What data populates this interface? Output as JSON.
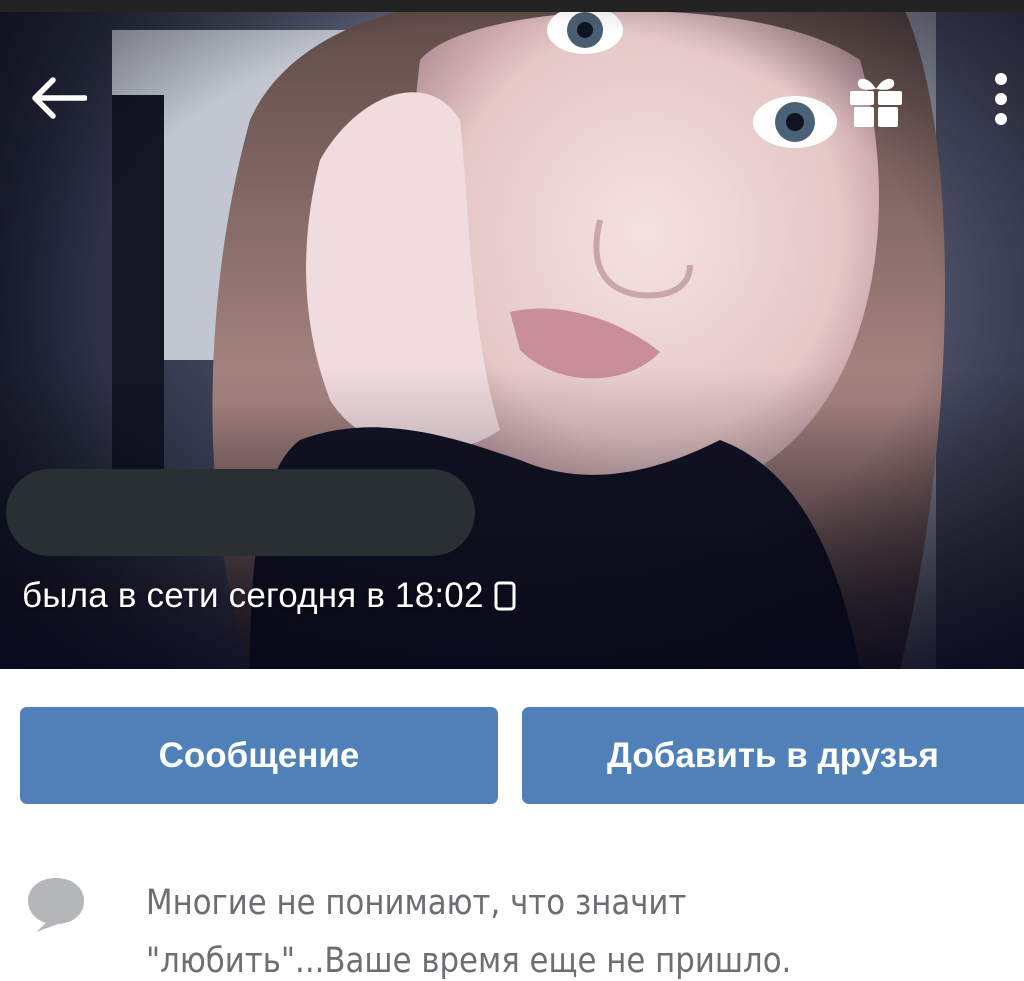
{
  "profile": {
    "online_status": "была в сети сегодня в 18:02",
    "online_device_icon": "phone-icon"
  },
  "actions": {
    "message_label": "Сообщение",
    "add_friend_label": "Добавить в друзья"
  },
  "status": {
    "icon": "comment-icon",
    "line1": "Многие не понимают, что значит",
    "line2": "\"любить\"...Ваше время еще не пришло."
  },
  "icons": {
    "back": "back-arrow-icon",
    "gift": "gift-icon",
    "more": "more-vertical-icon"
  },
  "colors": {
    "button_bg": "#4f80b7",
    "button_text": "#ffffff",
    "status_text": "#6d6d72",
    "comment_icon": "#b4b6ba"
  }
}
